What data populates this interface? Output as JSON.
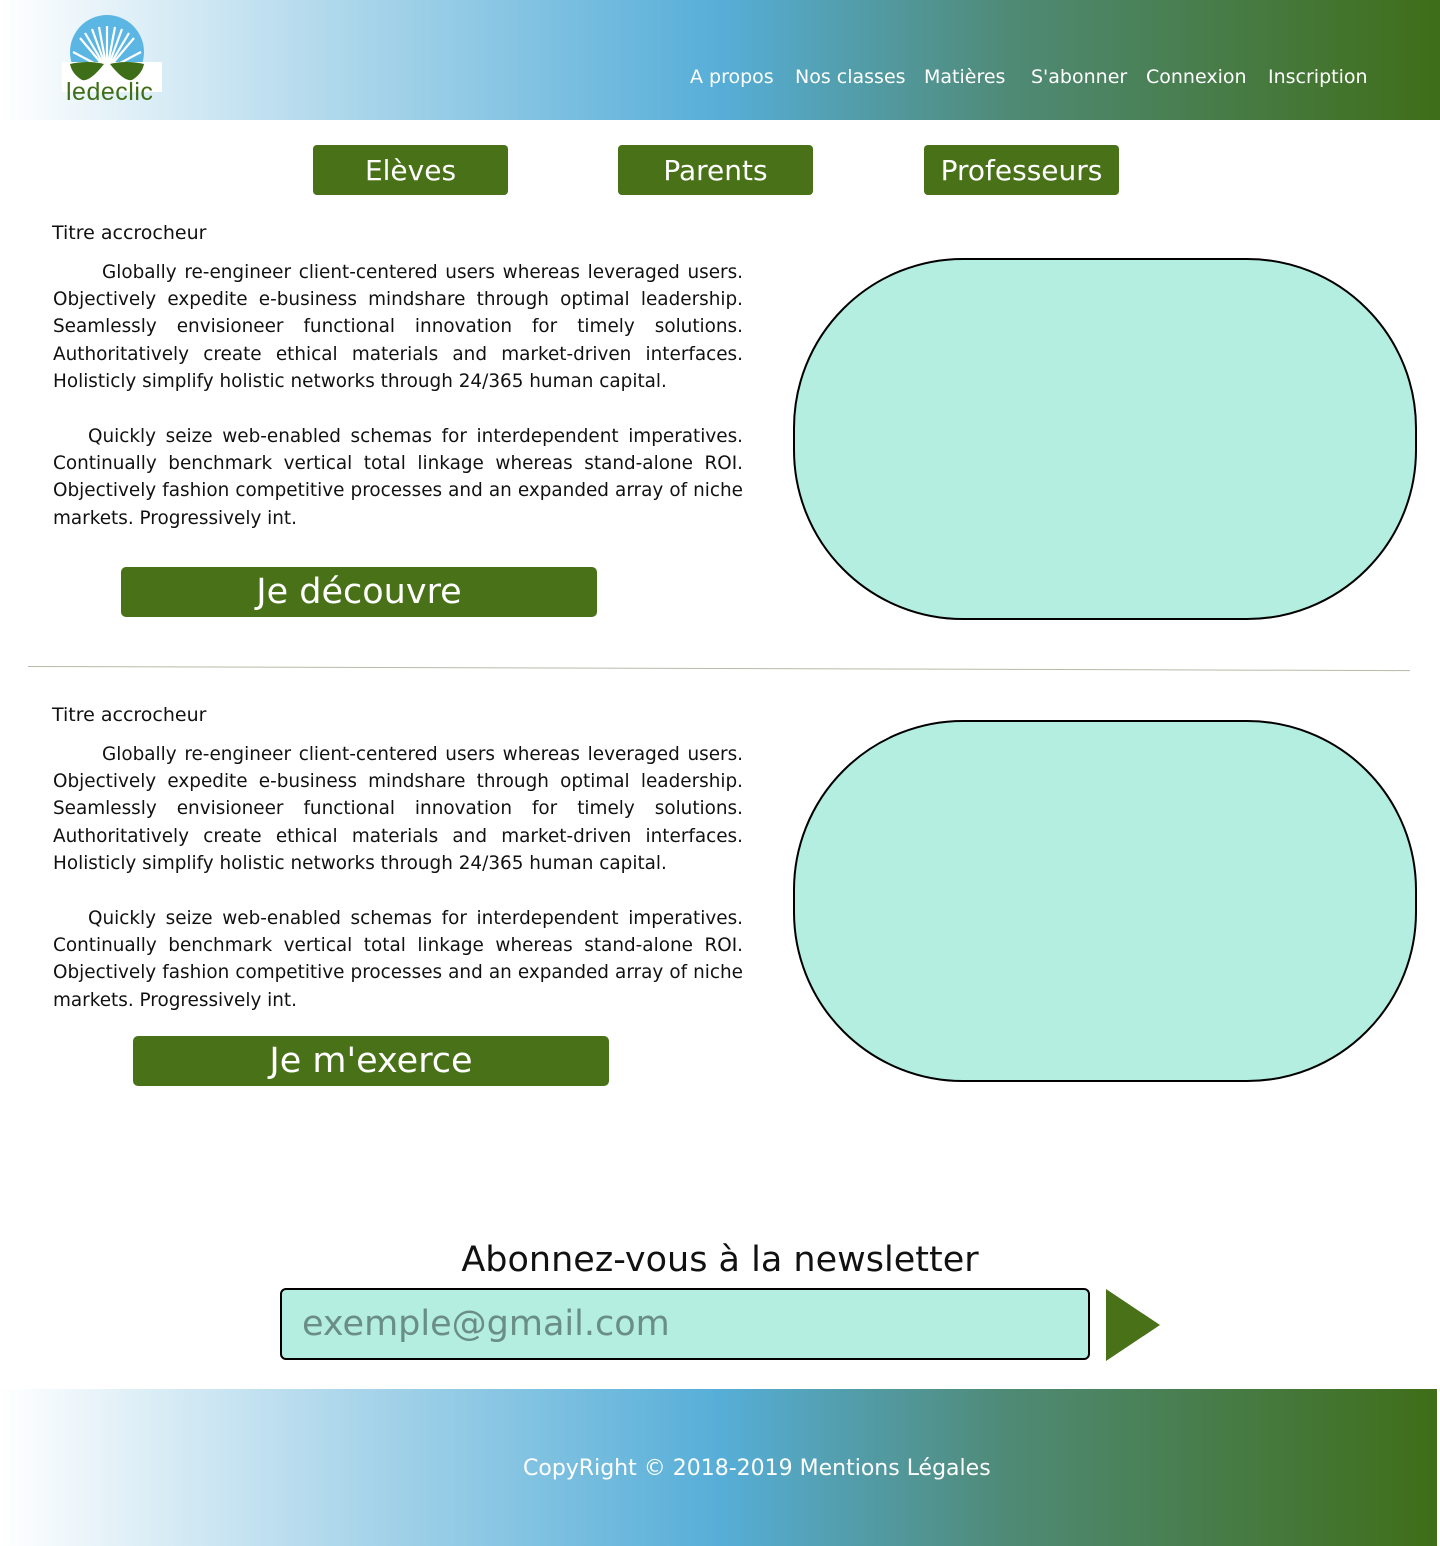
{
  "header": {
    "logo_text": "ledeclic",
    "nav": [
      "A propos",
      "Nos classes",
      "Matières",
      "S'abonner",
      "Connexion",
      "Inscription"
    ]
  },
  "tabs": [
    "Elèves",
    "Parents",
    "Professeurs"
  ],
  "sections": [
    {
      "title": "Titre accrocheur",
      "paragraphs": [
        "Globally re-engineer client-centered users whereas leveraged users. Objectively expedite e-business mindshare through optimal leadership. Seamlessly envisioneer functional innovation for timely solutions. Authoritatively create ethical materials and market-driven interfaces. Holisticly simplify holistic networks through 24/365 human capital.",
        "Quickly seize web-enabled schemas for interdependent imperatives. Continually benchmark vertical total linkage whereas stand-alone ROI. Objectively fashion competitive processes and an expanded array of niche markets. Progressively int."
      ],
      "button": "Je découvre"
    },
    {
      "title": "Titre accrocheur",
      "paragraphs": [
        "Globally re-engineer client-centered users whereas leveraged users. Objectively expedite e-business mindshare through optimal leadership. Seamlessly envisioneer functional innovation for timely solutions. Authoritatively create ethical materials and market-driven interfaces. Holisticly simplify holistic networks through 24/365 human capital.",
        "Quickly seize web-enabled schemas for interdependent imperatives. Continually benchmark vertical total linkage whereas stand-alone ROI. Objectively fashion competitive processes and an expanded array of niche markets. Progressively int."
      ],
      "button": "Je m'exerce"
    }
  ],
  "newsletter": {
    "title": "Abonnez-vous à la newsletter",
    "placeholder": "exemple@gmail.com",
    "submit_icon": "play-arrow-icon"
  },
  "footer": {
    "copyright": "CopyRight © 2018-2019  Mentions Légales"
  },
  "colors": {
    "brand_green": "#487118",
    "blob_fill": "#b3eee0",
    "gradient_blue": "#56aed8"
  }
}
